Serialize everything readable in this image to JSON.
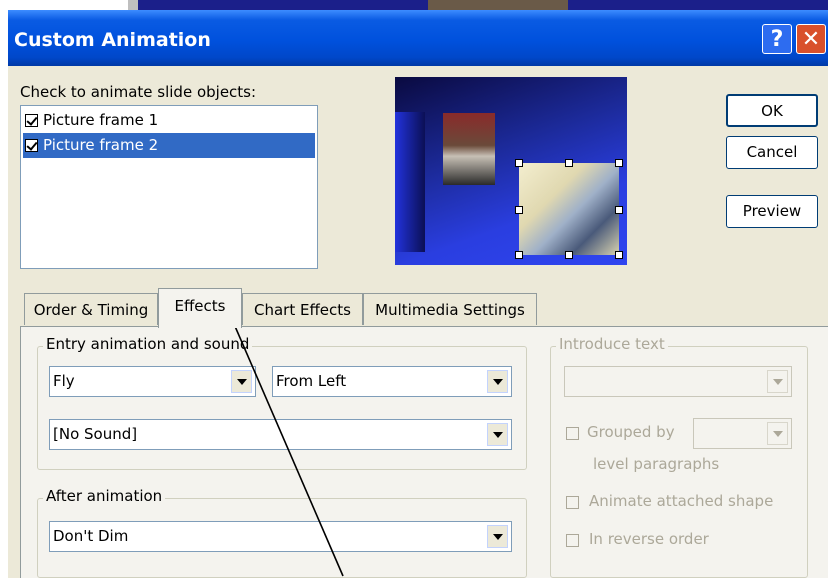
{
  "dialog": {
    "title": "Custom Animation",
    "help_glyph": "?",
    "close_glyph": "✕"
  },
  "objects": {
    "label": "Check to animate slide objects:",
    "items": [
      {
        "label": "Picture frame 1",
        "checked": true,
        "selected": false
      },
      {
        "label": "Picture frame 2",
        "checked": true,
        "selected": true
      }
    ]
  },
  "buttons": {
    "ok": "OK",
    "cancel": "Cancel",
    "preview": "Preview"
  },
  "tabs": [
    {
      "label": "Order & Timing",
      "active": false
    },
    {
      "label": "Effects",
      "active": true
    },
    {
      "label": "Chart Effects",
      "active": false
    },
    {
      "label": "Multimedia Settings",
      "active": false
    }
  ],
  "entry": {
    "legend": "Entry animation and sound",
    "effect": "Fly",
    "direction": "From Left",
    "sound": "[No Sound]"
  },
  "after": {
    "legend": "After animation",
    "value": "Don't Dim"
  },
  "introduce": {
    "legend": "Introduce text",
    "value": "",
    "grouped_by": "Grouped by",
    "grouped_value": "",
    "level_paragraphs": "level paragraphs",
    "animate_attached": "Animate attached shape",
    "reverse_order": "In reverse order"
  },
  "colors": {
    "titlebar": "#0051dd",
    "selection": "#316ac5",
    "dialog_bg": "#ece9d8",
    "panel_bg": "#f4f3ee"
  }
}
